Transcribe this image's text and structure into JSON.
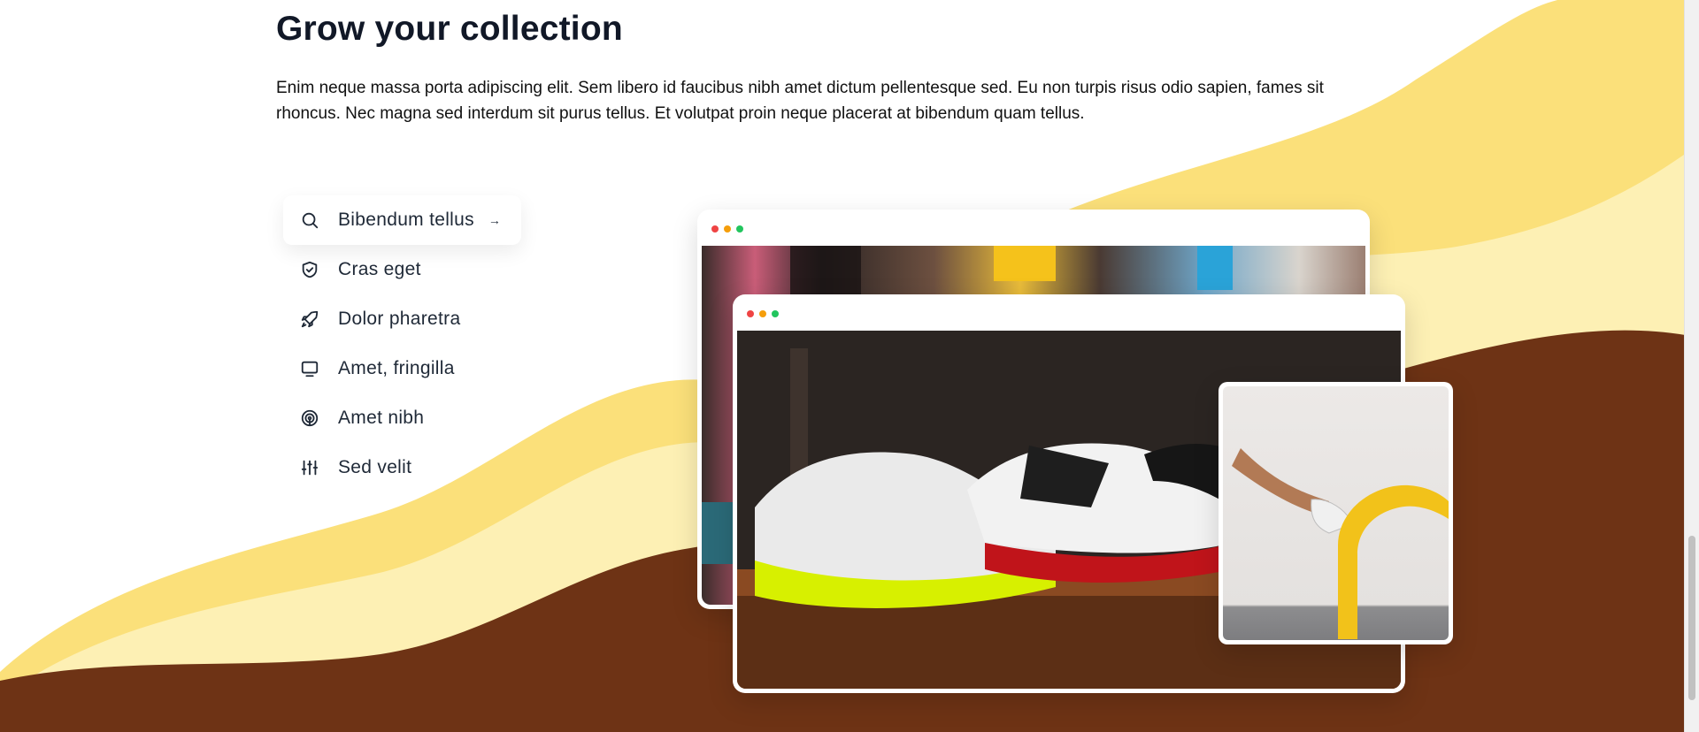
{
  "section": {
    "title": "Grow your collection",
    "description": "Enim neque massa porta adipiscing elit. Sem libero id faucibus nibh amet dictum pellentesque sed. Eu non turpis risus odio sapien, fames sit rhoncus. Nec magna sed interdum sit purus tellus. Et volutpat proin neque placerat at bibendum quam tellus."
  },
  "features": [
    {
      "label": "Bibendum tellus",
      "icon": "search-icon",
      "active": true
    },
    {
      "label": "Cras eget",
      "icon": "shield-check-icon"
    },
    {
      "label": "Dolor pharetra",
      "icon": "rocket-icon"
    },
    {
      "label": "Amet, fringilla",
      "icon": "monitor-icon"
    },
    {
      "label": "Amet nibh",
      "icon": "signal-icon"
    },
    {
      "label": "Sed velit",
      "icon": "sliders-icon"
    }
  ],
  "colors": {
    "wave_dark": "#6e3315",
    "wave_yellow": "#fbe07a",
    "wave_light": "#fdf0b4",
    "text": "#111827"
  }
}
